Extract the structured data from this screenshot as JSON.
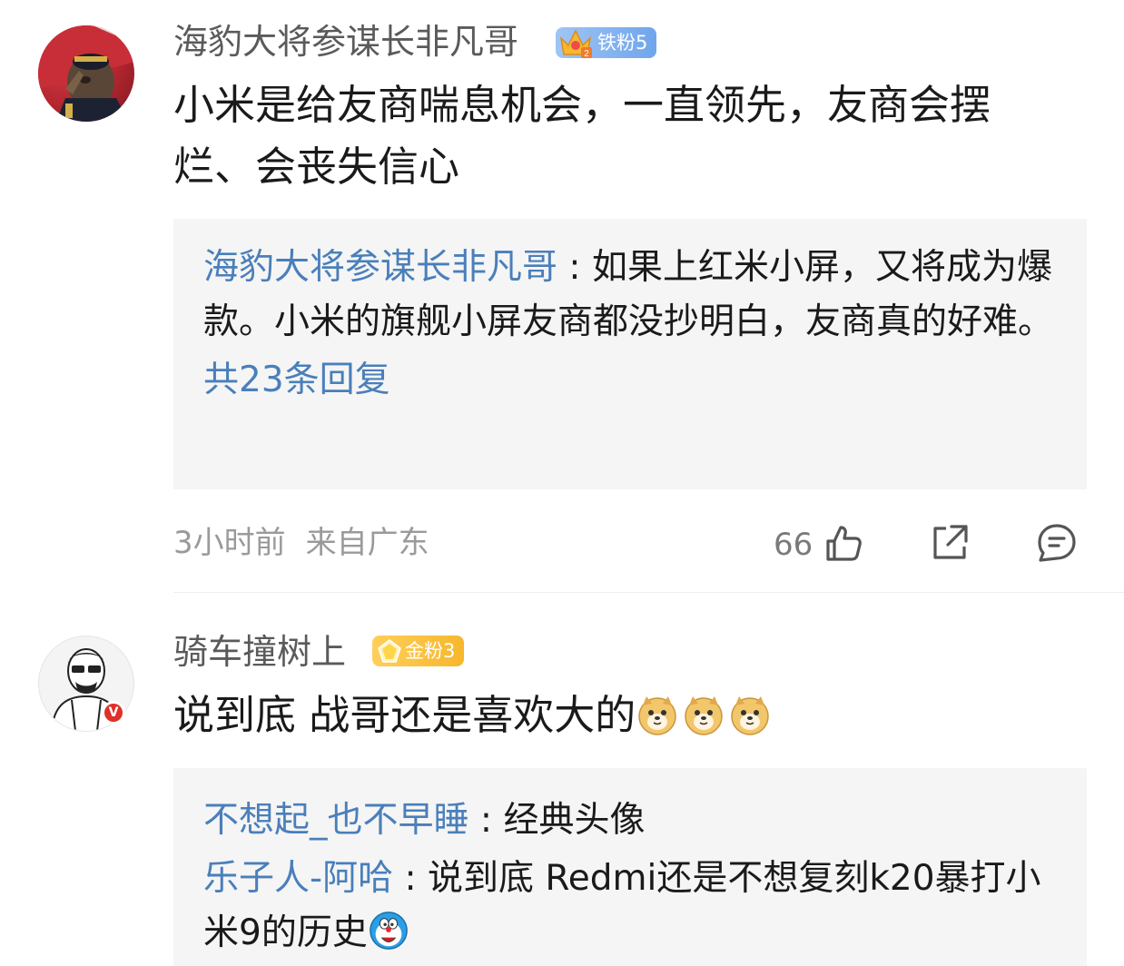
{
  "comments": [
    {
      "username": "海豹大将参谋长非凡哥",
      "badge": "铁粉5",
      "text": "小米是给友商喘息机会，一直领先，友商会摆\n烂、会丧失信心",
      "replies": [
        {
          "name": "海豹大将参谋长非凡哥",
          "sep": " : ",
          "text": "如果上红米小屏，又将成为爆款。小米的旗舰小屏友商都没抄明白，友商真的好难。"
        }
      ],
      "reply_count": "共23条回复",
      "time": "3小时前",
      "location": "来自广东",
      "likes": "66"
    },
    {
      "username": "骑车撞树上",
      "badge": "金粉3",
      "verified": "V",
      "text": "说到底 战哥还是喜欢大的",
      "replies": [
        {
          "name": "不想起_也不早睡",
          "sep": " : ",
          "text": "经典头像"
        },
        {
          "name": "乐子人-阿哈",
          "sep": " : ",
          "text": "说到底 Redmi还是不想复刻k20暴打小米9的历史"
        }
      ]
    }
  ],
  "icons": {
    "like": "thumbs-up-icon",
    "share": "share-icon",
    "comment": "comment-icon",
    "emoji": "doge-emoji",
    "emoji2": "doraemon-emoji"
  },
  "colors": {
    "link": "#4a7fba",
    "meta": "#9a9a9a",
    "reply_bg": "#f5f5f5"
  }
}
